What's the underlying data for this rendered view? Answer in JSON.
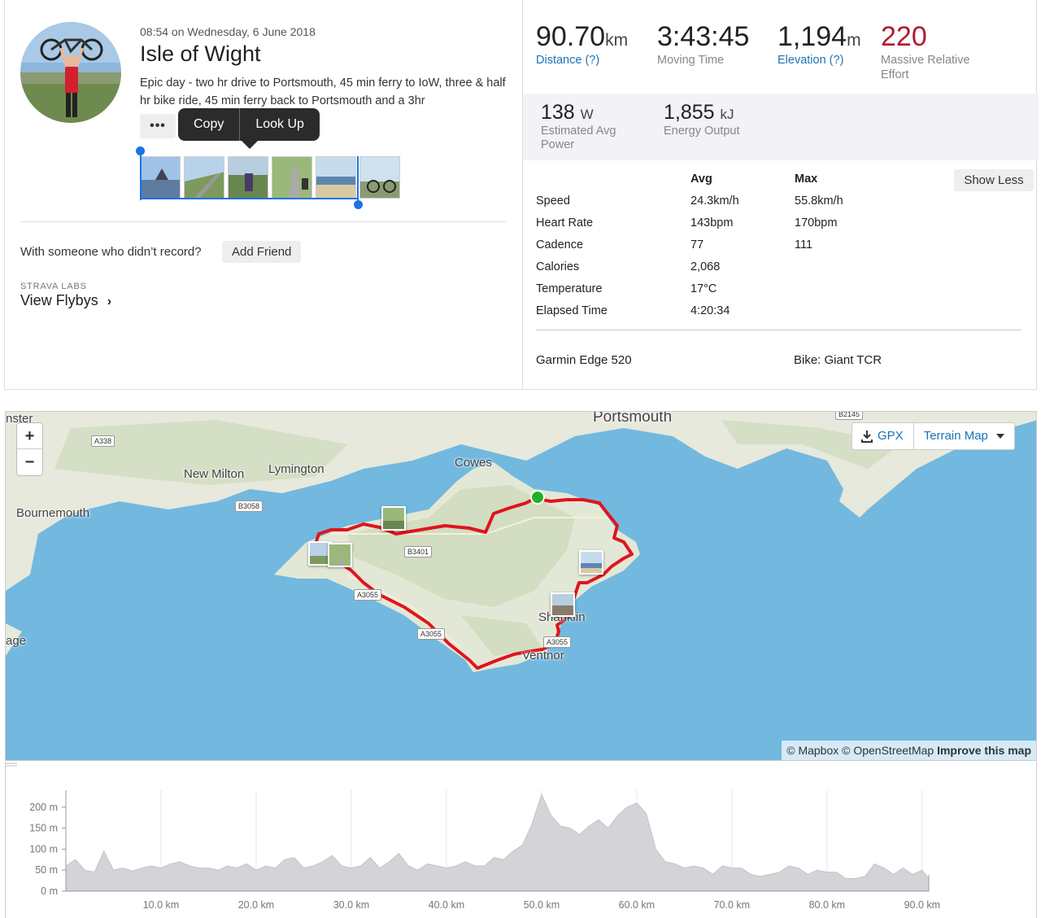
{
  "activity": {
    "date": "08:54 on Wednesday, 6 June 2018",
    "title": "Isle of Wight",
    "description": "Epic day - two hr drive to Portsmouth, 45 min ferry to IoW, three & half hr bike ride, 45 min ferry back to Portsmouth and a 3hr"
  },
  "context_menu": {
    "more": "•••",
    "copy": "Copy",
    "lookup": "Look Up"
  },
  "friend": {
    "prompt": "With someone who didn’t record?",
    "button": "Add Friend"
  },
  "labs": {
    "label": "STRAVA LABS",
    "link": "View Flybys"
  },
  "stats": {
    "distance": {
      "value": "90.70",
      "unit": "km",
      "label": "Distance (?)"
    },
    "moving_time": {
      "value": "3:43:45",
      "label": "Moving Time"
    },
    "elevation": {
      "value": "1,194",
      "unit": "m",
      "label": "Elevation (?)"
    },
    "effort": {
      "value": "220",
      "label_1": "Massive Relative",
      "label_2": "Effort"
    },
    "power": {
      "value": "138",
      "unit": "W",
      "label_1": "Estimated Avg",
      "label_2": "Power"
    },
    "energy": {
      "value": "1,855",
      "unit": "kJ",
      "label": "Energy Output"
    }
  },
  "more_stats": {
    "col_avg": "Avg",
    "col_max": "Max",
    "show_less": "Show Less",
    "rows": [
      {
        "label": "Speed",
        "avg": "24.3km/h",
        "max": "55.8km/h"
      },
      {
        "label": "Heart Rate",
        "avg": "143bpm",
        "max": "170bpm"
      },
      {
        "label": "Cadence",
        "avg": "77",
        "max": "111"
      },
      {
        "label": "Calories",
        "avg": "2,068",
        "max": ""
      },
      {
        "label": "Temperature",
        "avg": "17°C",
        "max": ""
      },
      {
        "label": "Elapsed Time",
        "avg": "4:20:34",
        "max": ""
      }
    ],
    "device": "Garmin Edge 520",
    "bike": "Bike: Giant TCR"
  },
  "map": {
    "zoom_in": "+",
    "zoom_out": "−",
    "gpx": "GPX",
    "terrain": "Terrain Map",
    "attribution_1": "© Mapbox © OpenStreetMap",
    "attribution_2": "Improve this map",
    "places": {
      "portsmouth": "Portsmouth",
      "cowes": "Cowes",
      "lymington": "Lymington",
      "new_milton": "New Milton",
      "bournemouth": "Bournemouth",
      "shanklin": "Shanklin",
      "ventnor": "Ventnor",
      "top_left": "nster",
      "left_edge": "age"
    },
    "roads": {
      "a338": "A338",
      "b3058": "B3058",
      "b3401": "B3401",
      "a3055a": "A3055",
      "a3055b": "A3055",
      "a3055c": "A3055",
      "b2145": "B2145"
    },
    "route_color": "#e0141e",
    "start_color": "#22b02a",
    "water_color": "#72b8df",
    "land_color": "#e8eadf"
  },
  "chart_data": {
    "type": "area",
    "xlabel": "",
    "ylabel": "",
    "x_ticks": [
      "10.0 km",
      "20.0 km",
      "30.0 km",
      "40.0 km",
      "50.0 km",
      "60.0 km",
      "70.0 km",
      "80.0 km",
      "90.0 km"
    ],
    "y_ticks": [
      "200 m",
      "150 m",
      "100 m",
      "50 m",
      "0 m"
    ],
    "xlim": [
      0,
      90.7
    ],
    "ylim": [
      0,
      250
    ],
    "grid": true,
    "x": [
      0,
      1,
      2,
      3,
      4,
      5,
      6,
      7,
      8,
      9,
      10,
      11,
      12,
      13,
      14,
      15,
      16,
      17,
      18,
      19,
      20,
      21,
      22,
      23,
      24,
      25,
      26,
      27,
      28,
      29,
      30,
      31,
      32,
      33,
      34,
      35,
      36,
      37,
      38,
      39,
      40,
      41,
      42,
      43,
      44,
      45,
      46,
      47,
      48,
      49,
      50,
      51,
      52,
      53,
      54,
      55,
      56,
      57,
      58,
      59,
      60,
      61,
      62,
      63,
      64,
      65,
      66,
      67,
      68,
      69,
      70,
      71,
      72,
      73,
      74,
      75,
      76,
      77,
      78,
      79,
      80,
      81,
      82,
      83,
      84,
      85,
      86,
      87,
      88,
      89,
      90,
      90.7
    ],
    "y": [
      60,
      75,
      50,
      45,
      95,
      50,
      55,
      48,
      55,
      60,
      55,
      65,
      70,
      60,
      55,
      55,
      50,
      60,
      55,
      65,
      50,
      60,
      55,
      75,
      80,
      55,
      60,
      70,
      85,
      60,
      55,
      60,
      80,
      55,
      70,
      90,
      60,
      50,
      65,
      60,
      55,
      60,
      70,
      60,
      60,
      80,
      75,
      95,
      110,
      160,
      230,
      180,
      155,
      150,
      135,
      155,
      170,
      150,
      180,
      200,
      210,
      185,
      100,
      70,
      65,
      55,
      60,
      55,
      40,
      60,
      55,
      55,
      40,
      35,
      40,
      45,
      60,
      55,
      40,
      50,
      45,
      45,
      30,
      30,
      35,
      65,
      55,
      40,
      55,
      40,
      50,
      30
    ]
  }
}
